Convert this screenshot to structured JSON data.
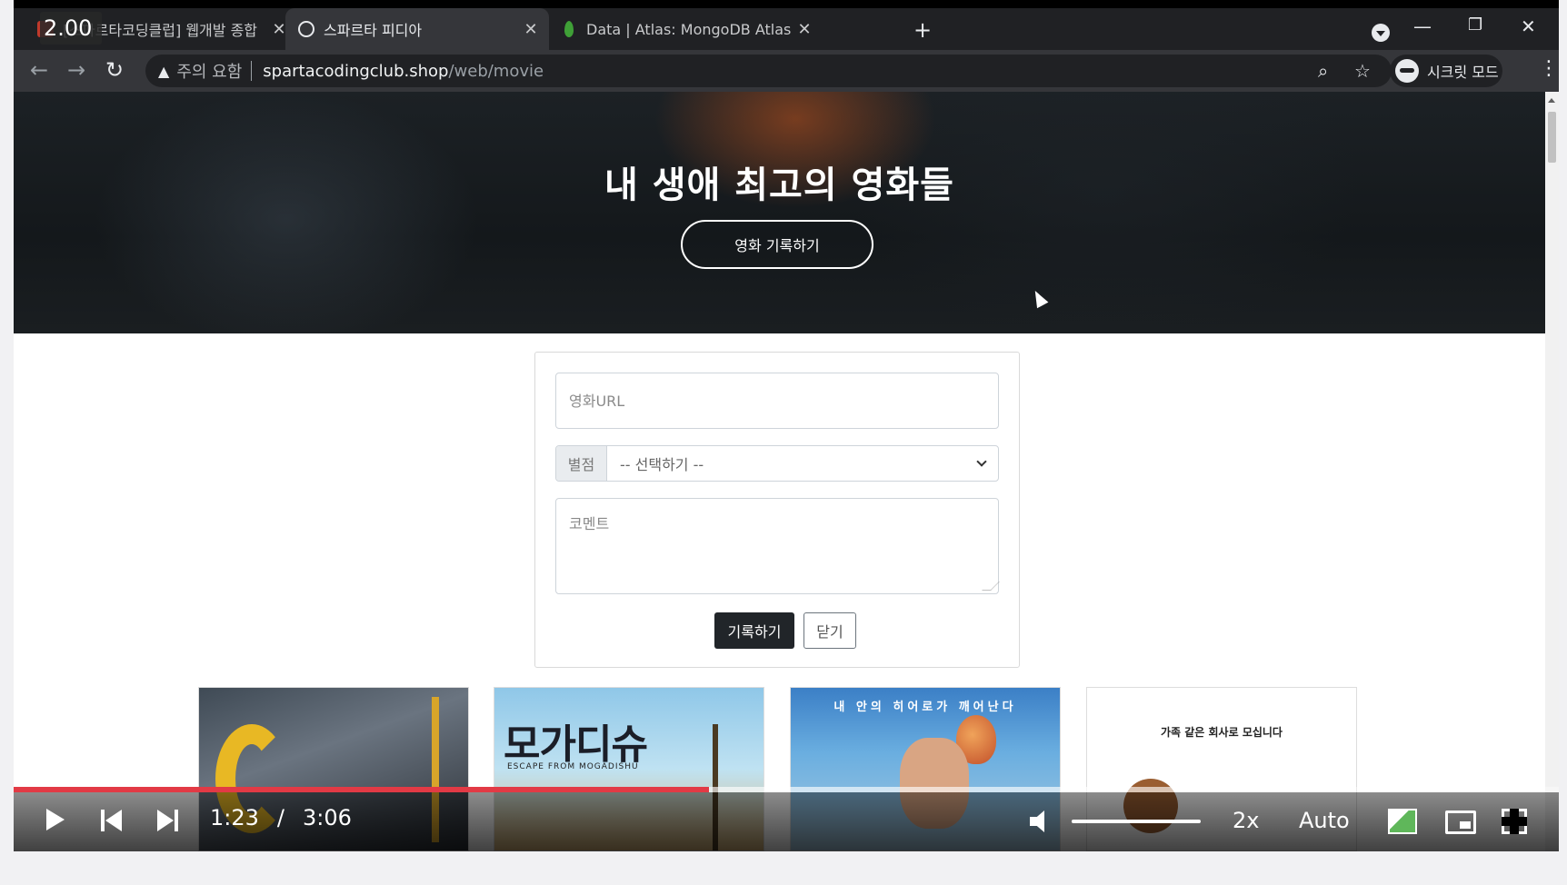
{
  "tabs": [
    {
      "title": "[스파르타코딩클럽] 웹개발 종합",
      "favicon": "sparta-favicon",
      "active": false
    },
    {
      "title": "스파르타 피디아",
      "favicon": "globe-icon",
      "active": true
    },
    {
      "title": "Data | Atlas: MongoDB Atlas",
      "favicon": "mongodb-leaf-icon",
      "active": false
    }
  ],
  "speed_overlay": "2.00",
  "address_bar": {
    "security_label": "주의 요함",
    "url_host": "spartacodingclub.shop",
    "url_path": "/web/movie"
  },
  "profile": {
    "label": "시크릿 모드"
  },
  "hero": {
    "title": "내 생애 최고의 영화들",
    "button_label": "영화 기록하기"
  },
  "form": {
    "url_placeholder": "영화URL",
    "rating_label": "별점",
    "rating_selected": "-- 선택하기 --",
    "comment_placeholder": "코멘트",
    "save_label": "기록하기",
    "close_label": "닫기"
  },
  "posters": [
    {
      "title": ""
    },
    {
      "title": "모가디슈",
      "subtitle": "ESCAPE FROM MOGADISHU"
    },
    {
      "title": "내 안의 히어로가 깨어난다"
    },
    {
      "title": "가족 같은 회사로 모십니다"
    }
  ],
  "player": {
    "current_time": "1:23",
    "separator": "/",
    "duration": "3:06",
    "playback_speed": "2x",
    "quality": "Auto",
    "progress": 0.45,
    "buffered": 0.83,
    "volume": 1.0,
    "accent_color": "#e23a45"
  }
}
